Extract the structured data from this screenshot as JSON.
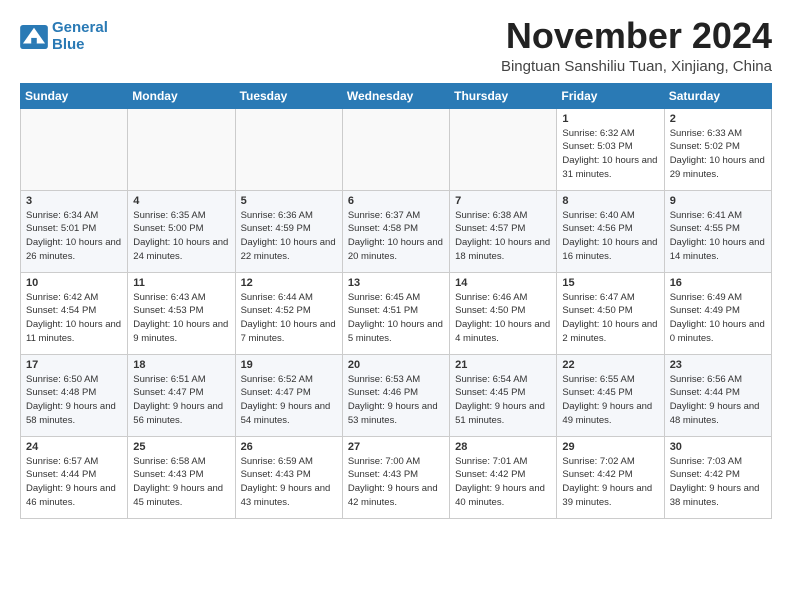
{
  "logo": {
    "line1": "General",
    "line2": "Blue"
  },
  "title": "November 2024",
  "subtitle": "Bingtuan Sanshiliu Tuan, Xinjiang, China",
  "weekdays": [
    "Sunday",
    "Monday",
    "Tuesday",
    "Wednesday",
    "Thursday",
    "Friday",
    "Saturday"
  ],
  "weeks": [
    [
      {
        "day": "",
        "info": ""
      },
      {
        "day": "",
        "info": ""
      },
      {
        "day": "",
        "info": ""
      },
      {
        "day": "",
        "info": ""
      },
      {
        "day": "",
        "info": ""
      },
      {
        "day": "1",
        "info": "Sunrise: 6:32 AM\nSunset: 5:03 PM\nDaylight: 10 hours and 31 minutes."
      },
      {
        "day": "2",
        "info": "Sunrise: 6:33 AM\nSunset: 5:02 PM\nDaylight: 10 hours and 29 minutes."
      }
    ],
    [
      {
        "day": "3",
        "info": "Sunrise: 6:34 AM\nSunset: 5:01 PM\nDaylight: 10 hours and 26 minutes."
      },
      {
        "day": "4",
        "info": "Sunrise: 6:35 AM\nSunset: 5:00 PM\nDaylight: 10 hours and 24 minutes."
      },
      {
        "day": "5",
        "info": "Sunrise: 6:36 AM\nSunset: 4:59 PM\nDaylight: 10 hours and 22 minutes."
      },
      {
        "day": "6",
        "info": "Sunrise: 6:37 AM\nSunset: 4:58 PM\nDaylight: 10 hours and 20 minutes."
      },
      {
        "day": "7",
        "info": "Sunrise: 6:38 AM\nSunset: 4:57 PM\nDaylight: 10 hours and 18 minutes."
      },
      {
        "day": "8",
        "info": "Sunrise: 6:40 AM\nSunset: 4:56 PM\nDaylight: 10 hours and 16 minutes."
      },
      {
        "day": "9",
        "info": "Sunrise: 6:41 AM\nSunset: 4:55 PM\nDaylight: 10 hours and 14 minutes."
      }
    ],
    [
      {
        "day": "10",
        "info": "Sunrise: 6:42 AM\nSunset: 4:54 PM\nDaylight: 10 hours and 11 minutes."
      },
      {
        "day": "11",
        "info": "Sunrise: 6:43 AM\nSunset: 4:53 PM\nDaylight: 10 hours and 9 minutes."
      },
      {
        "day": "12",
        "info": "Sunrise: 6:44 AM\nSunset: 4:52 PM\nDaylight: 10 hours and 7 minutes."
      },
      {
        "day": "13",
        "info": "Sunrise: 6:45 AM\nSunset: 4:51 PM\nDaylight: 10 hours and 5 minutes."
      },
      {
        "day": "14",
        "info": "Sunrise: 6:46 AM\nSunset: 4:50 PM\nDaylight: 10 hours and 4 minutes."
      },
      {
        "day": "15",
        "info": "Sunrise: 6:47 AM\nSunset: 4:50 PM\nDaylight: 10 hours and 2 minutes."
      },
      {
        "day": "16",
        "info": "Sunrise: 6:49 AM\nSunset: 4:49 PM\nDaylight: 10 hours and 0 minutes."
      }
    ],
    [
      {
        "day": "17",
        "info": "Sunrise: 6:50 AM\nSunset: 4:48 PM\nDaylight: 9 hours and 58 minutes."
      },
      {
        "day": "18",
        "info": "Sunrise: 6:51 AM\nSunset: 4:47 PM\nDaylight: 9 hours and 56 minutes."
      },
      {
        "day": "19",
        "info": "Sunrise: 6:52 AM\nSunset: 4:47 PM\nDaylight: 9 hours and 54 minutes."
      },
      {
        "day": "20",
        "info": "Sunrise: 6:53 AM\nSunset: 4:46 PM\nDaylight: 9 hours and 53 minutes."
      },
      {
        "day": "21",
        "info": "Sunrise: 6:54 AM\nSunset: 4:45 PM\nDaylight: 9 hours and 51 minutes."
      },
      {
        "day": "22",
        "info": "Sunrise: 6:55 AM\nSunset: 4:45 PM\nDaylight: 9 hours and 49 minutes."
      },
      {
        "day": "23",
        "info": "Sunrise: 6:56 AM\nSunset: 4:44 PM\nDaylight: 9 hours and 48 minutes."
      }
    ],
    [
      {
        "day": "24",
        "info": "Sunrise: 6:57 AM\nSunset: 4:44 PM\nDaylight: 9 hours and 46 minutes."
      },
      {
        "day": "25",
        "info": "Sunrise: 6:58 AM\nSunset: 4:43 PM\nDaylight: 9 hours and 45 minutes."
      },
      {
        "day": "26",
        "info": "Sunrise: 6:59 AM\nSunset: 4:43 PM\nDaylight: 9 hours and 43 minutes."
      },
      {
        "day": "27",
        "info": "Sunrise: 7:00 AM\nSunset: 4:43 PM\nDaylight: 9 hours and 42 minutes."
      },
      {
        "day": "28",
        "info": "Sunrise: 7:01 AM\nSunset: 4:42 PM\nDaylight: 9 hours and 40 minutes."
      },
      {
        "day": "29",
        "info": "Sunrise: 7:02 AM\nSunset: 4:42 PM\nDaylight: 9 hours and 39 minutes."
      },
      {
        "day": "30",
        "info": "Sunrise: 7:03 AM\nSunset: 4:42 PM\nDaylight: 9 hours and 38 minutes."
      }
    ]
  ]
}
